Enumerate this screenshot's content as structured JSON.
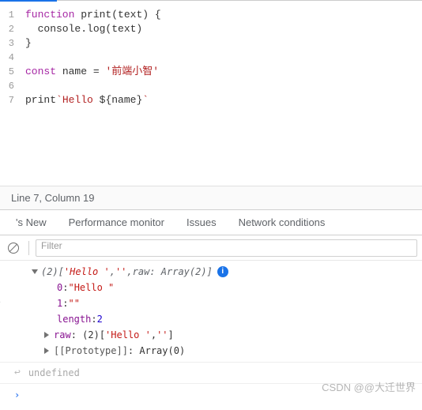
{
  "editor": {
    "lines": [
      "1",
      "2",
      "3",
      "4",
      "5",
      "6",
      "7"
    ],
    "code": {
      "l1_kw": "function",
      "l1_fn": " print",
      "l1_p": "(text) {",
      "l2": "  console.log(text)",
      "l3": "}",
      "l5_kw": "const",
      "l5_rest": " name = ",
      "l5_str": "'前端小智'",
      "l7_fn": "print",
      "l7_tick1": "`",
      "l7_h": "Hello ",
      "l7_d1": "${",
      "l7_v": "name",
      "l7_d2": "}",
      "l7_tick2": "`"
    }
  },
  "status": {
    "text": "Line 7, Column 19"
  },
  "tabs": {
    "t1": "'s New",
    "t2": "Performance monitor",
    "t3": "Issues",
    "t4": "Network conditions"
  },
  "filter": {
    "placeholder": "Filter"
  },
  "console": {
    "summary_pre": "(2) ",
    "summary_arr_open": "[",
    "s0": "'Hello '",
    "s_comma": ", ",
    "s1": "''",
    "s_rawlbl": "raw",
    "s_rawv": ": Array(2)",
    "summary_arr_close": "]",
    "k0": "0",
    "v0": "\"Hello \"",
    "k1": "1",
    "v1": "\"\"",
    "klen": "length",
    "vlen": "2",
    "kraw": "raw",
    "raw_pre": ": (2) ",
    "raw_a0": "'Hello '",
    "raw_a1": "''",
    "kproto": "[[Prototype]]",
    "vproto": ": Array(0)",
    "ret": "undefined"
  },
  "watermark": "CSDN @@大迁世界"
}
